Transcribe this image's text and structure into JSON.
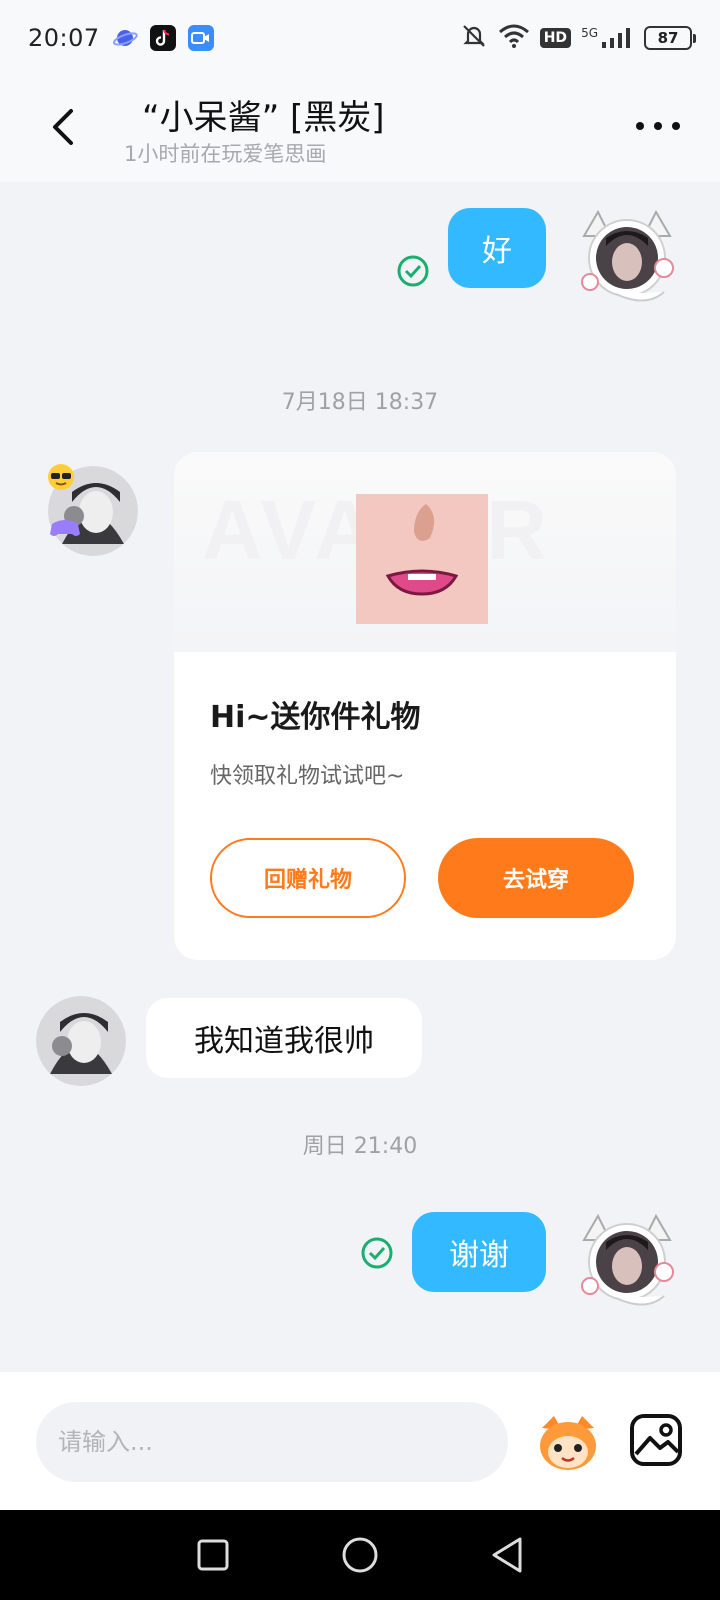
{
  "status_bar": {
    "time": "20:07",
    "battery": "87",
    "network": "5G",
    "hd": "HD",
    "icons": [
      "planet-app-icon",
      "tiktok-app-icon",
      "video-app-icon",
      "mute-bell-icon",
      "wifi-icon",
      "signal-icon"
    ]
  },
  "header": {
    "title": "“小呆酱” [黑炭]",
    "subtitle": "1小时前在玩爱笔思画"
  },
  "messages": [
    {
      "from": "me",
      "text": "好",
      "status": "sent-check-icon"
    },
    {
      "timestamp": "7月18日 18:37"
    },
    {
      "from": "them",
      "type": "gift-card",
      "gift": {
        "title": "Hi~送你件礼物",
        "desc": "快领取礼物试试吧~",
        "btn_return": "回赠礼物",
        "btn_try": "去试穿"
      }
    },
    {
      "from": "them",
      "text": "我知道我很帅"
    },
    {
      "timestamp": "周日 21:40"
    },
    {
      "from": "me",
      "text": "谢谢",
      "status": "sent-check-icon"
    }
  ],
  "input": {
    "placeholder": "请输入..."
  },
  "colors": {
    "my_bubble": "#33b9ff",
    "accent_orange": "#ff7a1a",
    "check_green": "#1aae6f",
    "background": "#f2f3f7"
  }
}
